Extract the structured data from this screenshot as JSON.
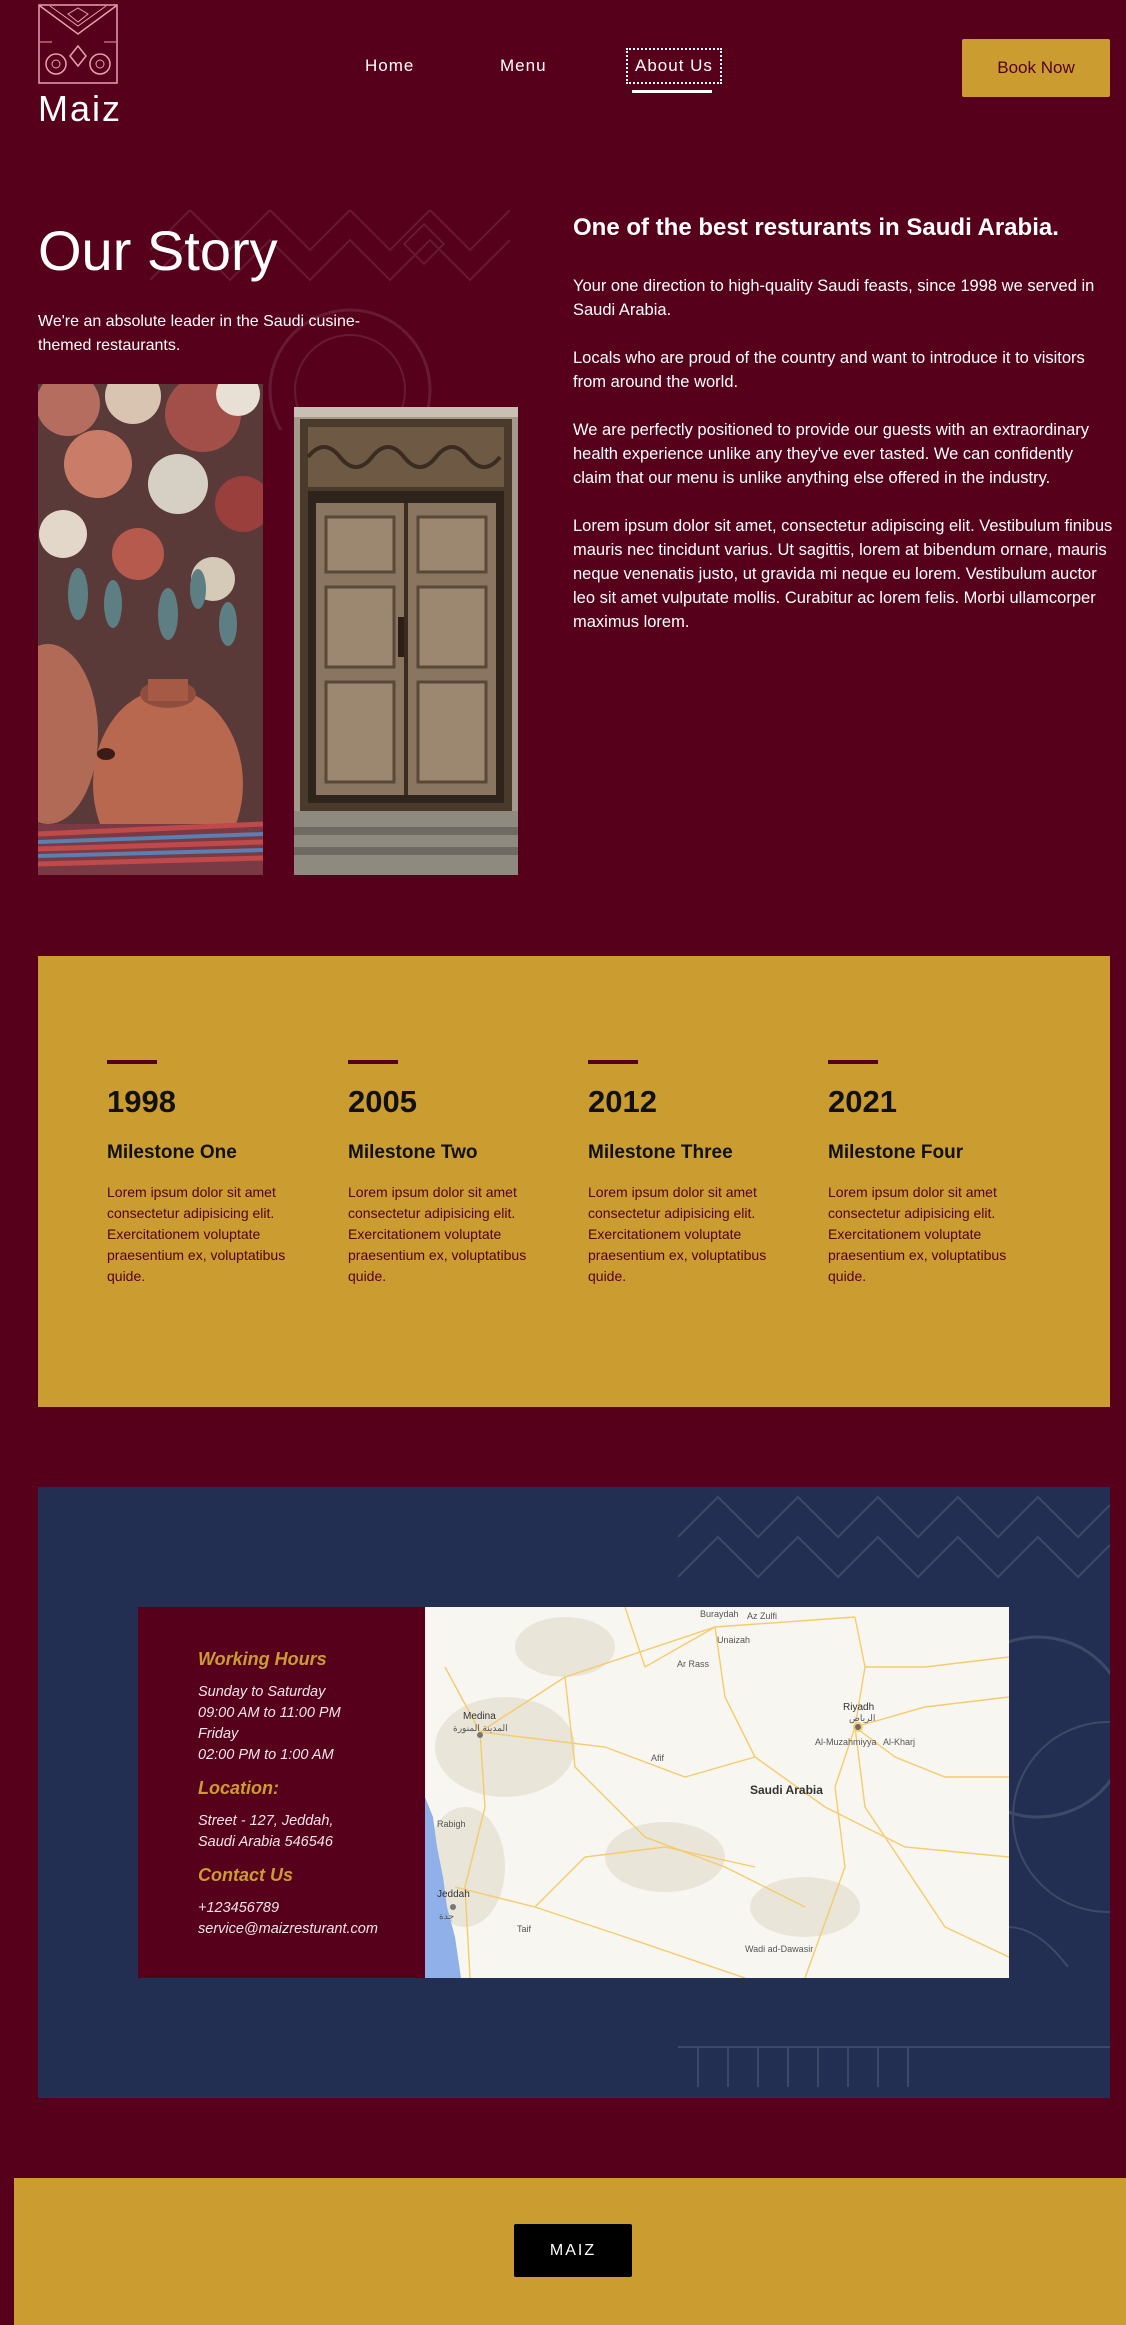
{
  "brand": {
    "name": "Maiz"
  },
  "nav": {
    "items": [
      {
        "label": "Home"
      },
      {
        "label": "Menu"
      },
      {
        "label": "About Us",
        "active": true
      }
    ],
    "book_label": "Book Now"
  },
  "story": {
    "title": "Our Story",
    "lead": "We're an absolute leader in the Saudi cusine-themed restaurants.",
    "heading": "One of the best resturants in Saudi Arabia.",
    "paragraphs": [
      "Your one direction to high-quality Saudi feasts, since 1998 we served in Saudi Arabia.",
      "Locals who are proud of the country and want to introduce it to visitors from around the world.",
      "We are perfectly positioned to provide our guests with an extraordinary health experience unlike any they've ever tasted. We can confidently claim that our menu is unlike anything else offered in the industry.",
      "Lorem ipsum dolor sit amet, consectetur adipiscing elit. Vestibulum finibus mauris nec tincidunt varius. Ut sagittis, lorem at bibendum ornare, mauris neque venenatis justo, ut gravida mi neque eu lorem. Vestibulum auctor leo sit amet vulputate mollis. Curabitur ac lorem felis. Morbi ullamcorper maximus lorem."
    ]
  },
  "milestones": [
    {
      "year": "1998",
      "title": "Milestone One",
      "body": "Lorem ipsum dolor sit amet consectetur adipisicing elit. Exercitationem voluptate praesentium ex, voluptatibus quide."
    },
    {
      "year": "2005",
      "title": "Milestone Two",
      "body": "Lorem ipsum dolor sit amet consectetur adipisicing elit. Exercitationem voluptate praesentium ex, voluptatibus quide."
    },
    {
      "year": "2012",
      "title": "Milestone Three",
      "body": "Lorem ipsum dolor sit amet consectetur adipisicing elit. Exercitationem voluptate praesentium ex, voluptatibus quide."
    },
    {
      "year": "2021",
      "title": "Milestone Four",
      "body": "Lorem ipsum dolor sit amet consectetur adipisicing elit. Exercitationem voluptate praesentium ex, voluptatibus quide."
    }
  ],
  "contact": {
    "hours_heading": "Working Hours",
    "hours_lines": [
      "Sunday to Saturday",
      "09:00 AM to 11:00 PM",
      "Friday",
      "02:00 PM to 1:00 AM"
    ],
    "location_heading": "Location:",
    "location_lines": [
      "Street - 127, Jeddah,",
      "Saudi Arabia 546546"
    ],
    "contact_heading": "Contact Us",
    "contact_lines": [
      "+123456789",
      "service@maizresturant.com"
    ]
  },
  "map": {
    "country": "Saudi Arabia",
    "places": [
      {
        "name": "Medina",
        "arabic": "المدينة المنورة"
      },
      {
        "name": "Riyadh",
        "arabic": "الرياض"
      },
      {
        "name": "Jeddah",
        "arabic": "جدة"
      },
      {
        "name": "Buraydah",
        "arabic": ""
      },
      {
        "name": "Az Zulfi",
        "arabic": ""
      },
      {
        "name": "Unaizah",
        "arabic": ""
      },
      {
        "name": "Ar Rass",
        "arabic": ""
      },
      {
        "name": "Afif",
        "arabic": ""
      },
      {
        "name": "Al-Muzahmiyya",
        "arabic": ""
      },
      {
        "name": "Al-Kharj",
        "arabic": ""
      },
      {
        "name": "Rabigh",
        "arabic": ""
      },
      {
        "name": "Taif",
        "arabic": ""
      },
      {
        "name": "Wadi ad-Dawasir",
        "arabic": ""
      }
    ]
  },
  "footer": {
    "label": "MAIZ"
  },
  "colors": {
    "maroon": "#56001b",
    "gold": "#cb9c30",
    "navy": "#232f52"
  }
}
